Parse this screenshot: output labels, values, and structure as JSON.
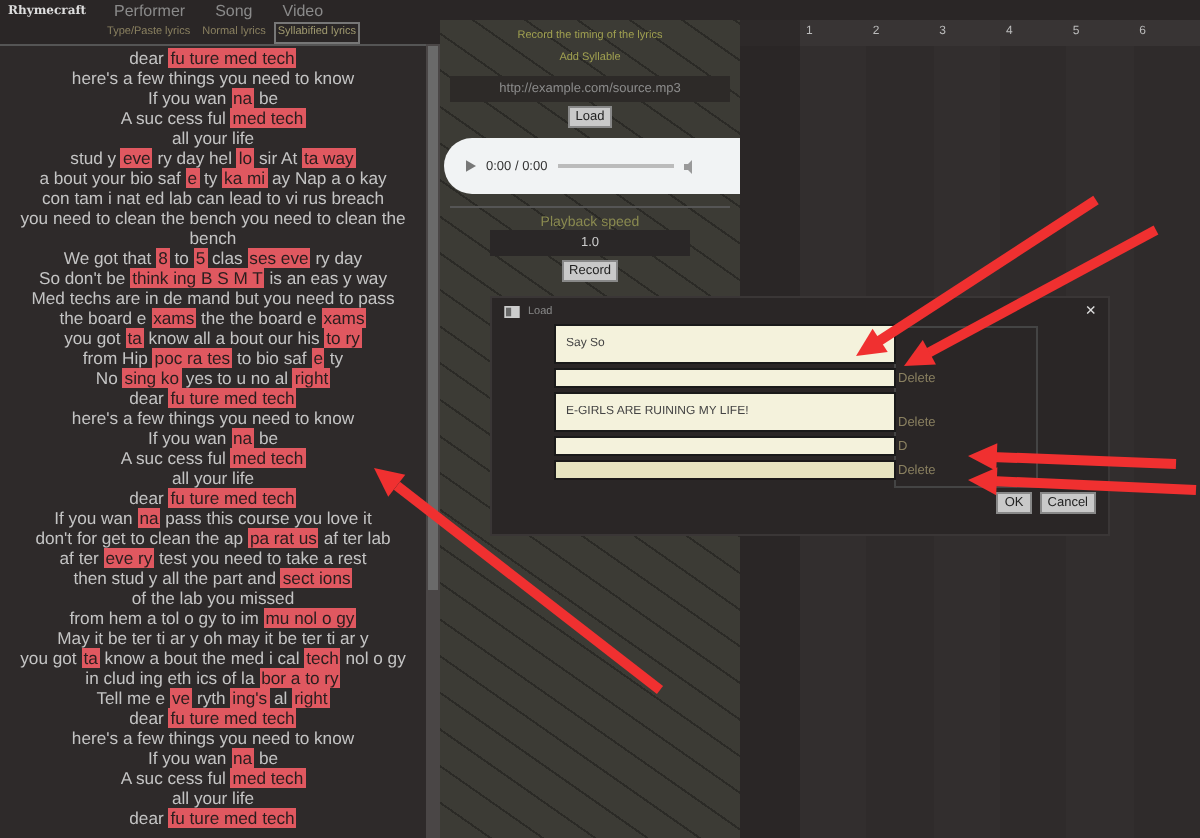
{
  "topbar": {
    "logo": "Rhymecraft",
    "nav": [
      "Performer",
      "Song",
      "Video"
    ]
  },
  "lyrics_tabs": [
    {
      "label": "Type/Paste lyrics",
      "selected": false
    },
    {
      "label": "Normal lyrics",
      "selected": false
    },
    {
      "label": "Syllabified lyrics",
      "selected": true
    }
  ],
  "lyrics": [
    {
      "segments": [
        {
          "text": "dear",
          "highlighted": false
        },
        {
          "text": "fu ture med tech",
          "highlighted": true
        }
      ]
    },
    {
      "segments": [
        {
          "text": "here's a few things you need to know",
          "highlighted": false
        }
      ]
    },
    {
      "segments": [
        {
          "text": "If you wan",
          "highlighted": false
        },
        {
          "text": "na",
          "highlighted": true
        },
        {
          "text": "be",
          "highlighted": false
        }
      ]
    },
    {
      "segments": [
        {
          "text": "A suc cess ful",
          "highlighted": false
        },
        {
          "text": "med tech",
          "highlighted": true
        }
      ]
    },
    {
      "segments": [
        {
          "text": "all your life",
          "highlighted": false
        }
      ]
    },
    {
      "segments": [
        {
          "text": "stud y",
          "highlighted": false
        },
        {
          "text": "eve",
          "highlighted": true
        },
        {
          "text": "ry day hel",
          "highlighted": false
        },
        {
          "text": "lo",
          "highlighted": true
        },
        {
          "text": "sir At",
          "highlighted": false
        },
        {
          "text": "ta way",
          "highlighted": true
        }
      ]
    },
    {
      "segments": [
        {
          "text": "a bout your bio saf",
          "highlighted": false
        },
        {
          "text": "e",
          "highlighted": true
        },
        {
          "text": "ty",
          "highlighted": false
        },
        {
          "text": "ka mi",
          "highlighted": true
        },
        {
          "text": "ay Nap a o kay",
          "highlighted": false
        }
      ]
    },
    {
      "segments": [
        {
          "text": "con tam i nat ed lab can lead to vi rus breach",
          "highlighted": false
        }
      ]
    },
    {
      "segments": [
        {
          "text": "you need to clean the bench you need to clean the bench",
          "highlighted": false
        }
      ]
    },
    {
      "segments": [
        {
          "text": "We got that",
          "highlighted": false
        },
        {
          "text": "8",
          "highlighted": true
        },
        {
          "text": "to",
          "highlighted": false
        },
        {
          "text": "5",
          "highlighted": true
        },
        {
          "text": "clas",
          "highlighted": false
        },
        {
          "text": "ses eve",
          "highlighted": true
        },
        {
          "text": "ry day",
          "highlighted": false
        }
      ]
    },
    {
      "segments": [
        {
          "text": "So don't be",
          "highlighted": false
        },
        {
          "text": "think ing B S M T",
          "highlighted": true
        },
        {
          "text": "is an eas y way",
          "highlighted": false
        }
      ]
    },
    {
      "segments": [
        {
          "text": "Med techs are in de mand but you need to pass",
          "highlighted": false
        }
      ]
    },
    {
      "segments": [
        {
          "text": "the board e",
          "highlighted": false
        },
        {
          "text": "xams",
          "highlighted": true
        },
        {
          "text": "the the board e",
          "highlighted": false
        },
        {
          "text": "xams",
          "highlighted": true
        }
      ]
    },
    {
      "segments": [
        {
          "text": "you got",
          "highlighted": false
        },
        {
          "text": "ta",
          "highlighted": true
        },
        {
          "text": "know all a bout our his",
          "highlighted": false
        },
        {
          "text": "to ry",
          "highlighted": true
        }
      ]
    },
    {
      "segments": [
        {
          "text": "from Hip",
          "highlighted": false
        },
        {
          "text": "poc ra tes",
          "highlighted": true
        },
        {
          "text": "to bio saf",
          "highlighted": false
        },
        {
          "text": "e",
          "highlighted": true
        },
        {
          "text": "ty",
          "highlighted": false
        }
      ]
    },
    {
      "segments": [
        {
          "text": "No",
          "highlighted": false
        },
        {
          "text": "sing ko",
          "highlighted": true
        },
        {
          "text": "yes to u no al",
          "highlighted": false
        },
        {
          "text": "right",
          "highlighted": true
        }
      ]
    },
    {
      "segments": [
        {
          "text": "dear",
          "highlighted": false
        },
        {
          "text": "fu ture med tech",
          "highlighted": true
        }
      ]
    },
    {
      "segments": [
        {
          "text": "here's a few things you need to know",
          "highlighted": false
        }
      ]
    },
    {
      "segments": [
        {
          "text": "If you wan",
          "highlighted": false
        },
        {
          "text": "na",
          "highlighted": true
        },
        {
          "text": "be",
          "highlighted": false
        }
      ]
    },
    {
      "segments": [
        {
          "text": "A suc cess ful",
          "highlighted": false
        },
        {
          "text": "med tech",
          "highlighted": true
        }
      ]
    },
    {
      "segments": [
        {
          "text": "all your life",
          "highlighted": false
        }
      ]
    },
    {
      "segments": [
        {
          "text": "dear",
          "highlighted": false
        },
        {
          "text": "fu ture med tech",
          "highlighted": true
        }
      ]
    },
    {
      "segments": [
        {
          "text": "If you wan",
          "highlighted": false
        },
        {
          "text": "na",
          "highlighted": true
        },
        {
          "text": "pass this course you love it",
          "highlighted": false
        }
      ]
    },
    {
      "segments": [
        {
          "text": "don't for get to clean the ap",
          "highlighted": false
        },
        {
          "text": "pa rat us",
          "highlighted": true
        },
        {
          "text": "af ter lab",
          "highlighted": false
        }
      ]
    },
    {
      "segments": [
        {
          "text": "af ter",
          "highlighted": false
        },
        {
          "text": "eve ry",
          "highlighted": true
        },
        {
          "text": "test you need to take a rest",
          "highlighted": false
        }
      ]
    },
    {
      "segments": [
        {
          "text": "then stud y all the part and",
          "highlighted": false
        },
        {
          "text": "sect ions",
          "highlighted": true
        },
        {
          "text": "of the lab you missed",
          "highlighted": false
        }
      ]
    },
    {
      "segments": [
        {
          "text": "from hem a tol o gy to im",
          "highlighted": false
        },
        {
          "text": "mu nol o gy",
          "highlighted": true
        }
      ]
    },
    {
      "segments": [
        {
          "text": "May it be ter ti ar y oh may it be ter ti ar y",
          "highlighted": false
        }
      ]
    },
    {
      "segments": [
        {
          "text": "you got",
          "highlighted": false
        },
        {
          "text": "ta",
          "highlighted": true
        },
        {
          "text": "know a bout the med i cal",
          "highlighted": false
        },
        {
          "text": "tech",
          "highlighted": true
        },
        {
          "text": "nol o gy",
          "highlighted": false
        }
      ]
    },
    {
      "segments": [
        {
          "text": "in clud ing eth ics of la",
          "highlighted": false
        },
        {
          "text": "bor a to ry",
          "highlighted": true
        }
      ]
    },
    {
      "segments": [
        {
          "text": "Tell me e",
          "highlighted": false
        },
        {
          "text": "ve",
          "highlighted": true
        },
        {
          "text": "ryth",
          "highlighted": false
        },
        {
          "text": "ing's",
          "highlighted": true
        },
        {
          "text": "al",
          "highlighted": false
        },
        {
          "text": "right",
          "highlighted": true
        }
      ]
    },
    {
      "segments": [
        {
          "text": "dear",
          "highlighted": false
        },
        {
          "text": "fu ture med tech",
          "highlighted": true
        }
      ]
    },
    {
      "segments": [
        {
          "text": "here's a few things you need to know",
          "highlighted": false
        }
      ]
    },
    {
      "segments": [
        {
          "text": "If you wan",
          "highlighted": false
        },
        {
          "text": "na",
          "highlighted": true
        },
        {
          "text": "be",
          "highlighted": false
        }
      ]
    },
    {
      "segments": [
        {
          "text": "A suc cess ful",
          "highlighted": false
        },
        {
          "text": "med tech",
          "highlighted": true
        }
      ]
    },
    {
      "segments": [
        {
          "text": "all your life",
          "highlighted": false
        }
      ]
    },
    {
      "segments": [
        {
          "text": "dear",
          "highlighted": false
        },
        {
          "text": "fu ture med tech",
          "highlighted": true
        }
      ]
    }
  ],
  "timing_panel": {
    "record_link": "Record the timing of the lyrics",
    "add_syllable_link": "Add Syllable",
    "url_placeholder": "http://example.com/source.mp3",
    "load_button": "Load",
    "audio_time": "0:00 / 0:00",
    "playback_speed_label": "Playback speed",
    "playback_speed": "1.0",
    "record_button": "Record"
  },
  "timeline": {
    "columns": [
      "1",
      "2",
      "3",
      "4",
      "5",
      "6"
    ]
  },
  "load_dialog": {
    "title": "Load",
    "close": "×",
    "entries": [
      {
        "value": "Say So"
      },
      {
        "delete": "Delete"
      },
      {
        "value": "E-GIRLS ARE RUINING MY LIFE!",
        "delete": "Delete"
      },
      {
        "delete": "D"
      },
      {
        "delete": "Delete"
      }
    ],
    "buttons": [
      "OK",
      "Cancel"
    ]
  }
}
